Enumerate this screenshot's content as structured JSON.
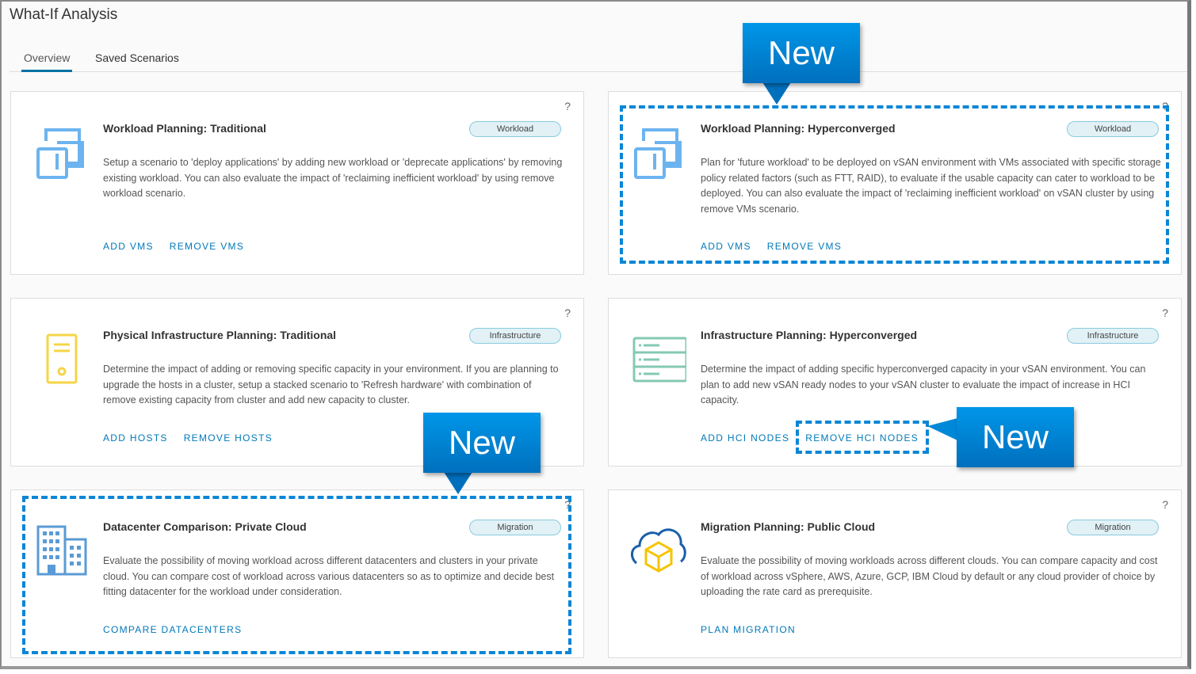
{
  "page_title": "What-If Analysis",
  "tabs": [
    {
      "label": "Overview",
      "active": true
    },
    {
      "label": "Saved Scenarios",
      "active": false
    }
  ],
  "help_label": "?",
  "callout_label": "New",
  "accent_color": "#0079b8",
  "cards": [
    {
      "title": "Workload Planning: Traditional",
      "badge": "Workload",
      "icon": "virtual-machines-icon",
      "description": "Setup a scenario to 'deploy applications' by adding new workload or 'deprecate applications' by removing existing workload. You can also evaluate the impact of 'reclaiming inefficient workload' by using remove workload scenario.",
      "actions": [
        "ADD VMS",
        "REMOVE VMS"
      ]
    },
    {
      "title": "Workload Planning: Hyperconverged",
      "badge": "Workload",
      "icon": "virtual-machines-icon",
      "description": "Plan for 'future workload' to be deployed on vSAN environment with VMs associated with specific storage policy related factors (such as FTT, RAID), to evaluate if the usable capacity can cater to workload to be deployed. You can also evaluate the impact of 'reclaiming inefficient workload' on vSAN cluster by using remove VMs scenario.",
      "actions": [
        "ADD VMS",
        "REMOVE VMS"
      ]
    },
    {
      "title": "Physical Infrastructure Planning: Traditional",
      "badge": "Infrastructure",
      "icon": "host-server-icon",
      "description": "Determine the impact of adding or removing specific capacity in your environment. If you are planning to upgrade the hosts in a cluster, setup a stacked scenario to 'Refresh hardware' with combination of remove existing capacity from cluster and add new capacity to cluster.",
      "actions": [
        "ADD HOSTS",
        "REMOVE HOSTS"
      ]
    },
    {
      "title": "Infrastructure Planning: Hyperconverged",
      "badge": "Infrastructure",
      "icon": "server-rack-icon",
      "description": "Determine the impact of adding specific hyperconverged capacity in your vSAN environment. You can plan to add new vSAN ready nodes to your vSAN cluster to evaluate the impact of increase in HCI capacity.",
      "actions": [
        "ADD HCI NODES",
        "REMOVE HCI NODES"
      ]
    },
    {
      "title": "Datacenter Comparison: Private Cloud",
      "badge": "Migration",
      "icon": "datacenter-building-icon",
      "description": "Evaluate the possibility of moving workload across different datacenters and clusters in your private cloud. You can compare cost of workload across various datacenters so as to optimize and decide best fitting datacenter for the workload under consideration.",
      "actions": [
        "COMPARE DATACENTERS"
      ]
    },
    {
      "title": "Migration Planning: Public Cloud",
      "badge": "Migration",
      "icon": "cloud-cube-icon",
      "description": "Evaluate the possibility of moving workloads across different clouds. You can compare capacity and cost of workload across vSphere, AWS, Azure, GCP, IBM Cloud by default or any cloud provider of choice by uploading the rate card as prerequisite.",
      "actions": [
        "PLAN MIGRATION"
      ]
    }
  ]
}
